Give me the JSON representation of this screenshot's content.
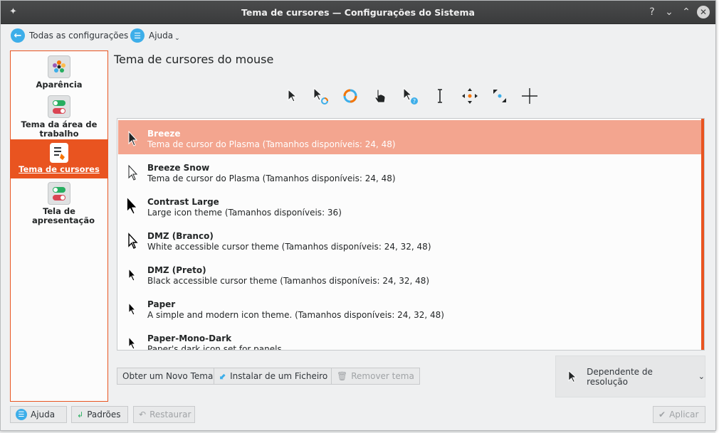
{
  "window": {
    "title": "Tema de cursores — Configurações do Sistema",
    "controls": [
      "?",
      "⌄",
      "⌃",
      "✕"
    ]
  },
  "topbar": {
    "back_label": "Todas as configurações",
    "help_label": "Ajuda"
  },
  "sidebar": {
    "items": [
      {
        "label": "Aparência",
        "icon": "appearance-icon"
      },
      {
        "label": "Tema da área de trabalho",
        "icon": "toggles-icon"
      },
      {
        "label": "Tema de cursores",
        "icon": "cursor-theme-icon",
        "active": true
      },
      {
        "label": "Tela de apresentação",
        "icon": "toggles-icon"
      }
    ]
  },
  "main": {
    "title": "Tema de cursores do mouse"
  },
  "themes": [
    {
      "name": "Breeze",
      "description": "Tema de cursor do Plasma (Tamanhos disponíveis: 24, 48)",
      "selected": true
    },
    {
      "name": "Breeze Snow",
      "description": "Tema de cursor do Plasma (Tamanhos disponíveis: 24, 48)"
    },
    {
      "name": "Contrast Large",
      "description": "Large icon theme (Tamanhos disponíveis: 36)"
    },
    {
      "name": "DMZ (Branco)",
      "description": "White accessible cursor theme (Tamanhos disponíveis: 24, 32, 48)"
    },
    {
      "name": "DMZ (Preto)",
      "description": "Black accessible cursor theme (Tamanhos disponíveis: 24, 32, 48)"
    },
    {
      "name": "Paper",
      "description": "A simple and modern icon theme. (Tamanhos disponíveis: 24, 32, 48)"
    },
    {
      "name": "Paper-Mono-Dark",
      "description": "Paper's dark icon set for panels"
    }
  ],
  "actions": {
    "get_new": "Obter um Novo Tema",
    "install": "Instalar de um Ficheiro",
    "remove": "Remover tema"
  },
  "size_select": {
    "value": "Dependente de resolução"
  },
  "footer": {
    "help": "Ajuda",
    "defaults": "Padrões",
    "reset": "Restaurar",
    "apply": "Aplicar"
  },
  "colors": {
    "accent": "#e95420",
    "selection": "#f3a58f",
    "link_blue": "#3daee9"
  }
}
